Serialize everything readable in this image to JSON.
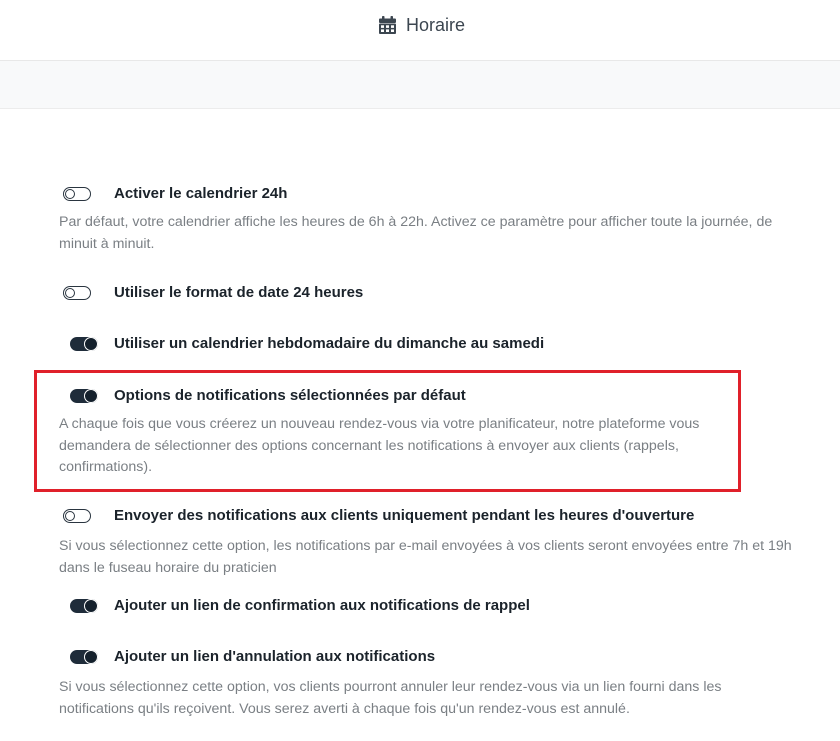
{
  "header": {
    "title": "Horaire",
    "icon": "calendar-icon"
  },
  "settings": [
    {
      "label": "Activer le calendrier 24h",
      "enabled": false,
      "description": "Par défaut, votre calendrier affiche les heures de 6h à 22h. Activez ce paramètre pour afficher toute la journée, de minuit à minuit."
    },
    {
      "label": "Utiliser le format de date 24 heures",
      "enabled": false,
      "description": ""
    },
    {
      "label": "Utiliser un calendrier hebdomadaire du dimanche au samedi",
      "enabled": true,
      "description": ""
    },
    {
      "label": "Options de notifications sélectionnées par défaut",
      "enabled": true,
      "description": "A chaque fois que vous créerez un nouveau rendez-vous via votre planificateur, notre plateforme vous demandera de sélectionner des options concernant les notifications à envoyer aux clients (rappels, confirmations)."
    },
    {
      "label": "Envoyer des notifications aux clients uniquement pendant les heures d'ouverture",
      "enabled": false,
      "description": "Si vous sélectionnez cette option, les notifications par e-mail envoyées à vos clients seront envoyées entre 7h et 19h dans le fuseau horaire du praticien"
    },
    {
      "label": "Ajouter un lien de confirmation aux notifications de rappel",
      "enabled": true,
      "description": ""
    },
    {
      "label": "Ajouter un lien d'annulation aux notifications",
      "enabled": true,
      "description": "Si vous sélectionnez cette option, vos clients pourront annuler leur rendez-vous via un lien fourni dans les notifications qu'ils reçoivent. Vous serez averti à chaque fois qu'un rendez-vous est annulé."
    }
  ],
  "highlight_color": "#e0202a",
  "toggle_on_color": "#1f2c3a"
}
